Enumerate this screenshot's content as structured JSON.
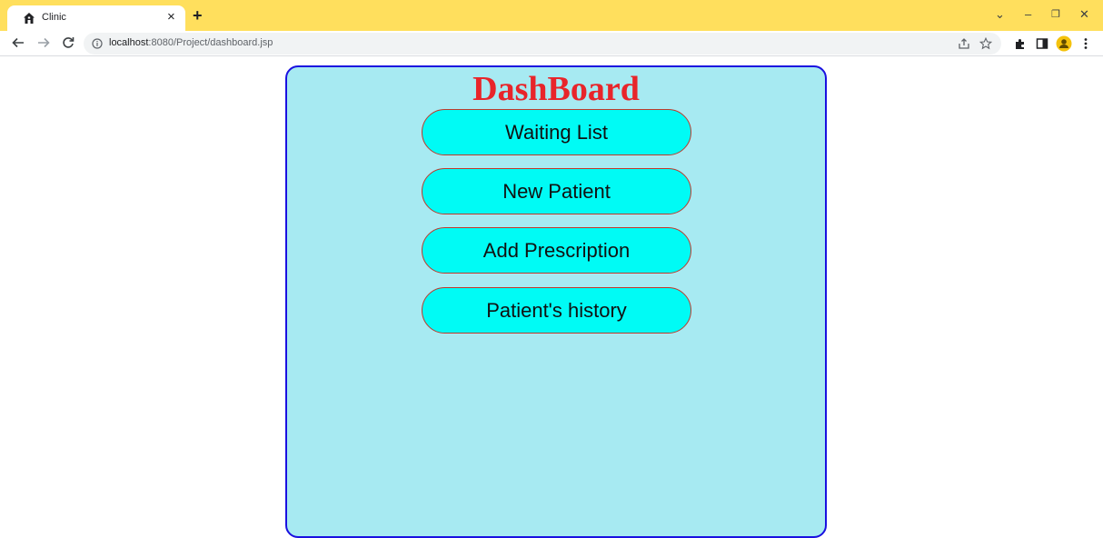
{
  "browser": {
    "tab_title": "Clinic",
    "tab_close": "×",
    "new_tab": "+",
    "url_host": "localhost",
    "url_path": ":8080/Project/dashboard.jsp",
    "icons": [
      "home-favicon",
      "back-icon",
      "forward-icon",
      "reload-icon",
      "info-icon",
      "share-icon",
      "star-icon",
      "extensions-icon",
      "sidepanel-icon",
      "profile-icon",
      "menu-icon"
    ],
    "window_controls": {
      "minimize": "–",
      "restore": "❐",
      "close": "✕",
      "tab_search": "⌄"
    }
  },
  "page": {
    "title": "DashBoard",
    "buttons": [
      {
        "label": "Waiting List"
      },
      {
        "label": "New Patient"
      },
      {
        "label": "Add Prescription"
      },
      {
        "label": "Patient's history"
      }
    ]
  },
  "colors": {
    "tabbar": "#ffdf5d",
    "panel_bg": "#a7eaf2",
    "panel_border": "#1a10e0",
    "title": "#e8252a",
    "button_bg": "#00fbf5",
    "button_border": "#c0392b",
    "profile": "#f4c20d"
  }
}
